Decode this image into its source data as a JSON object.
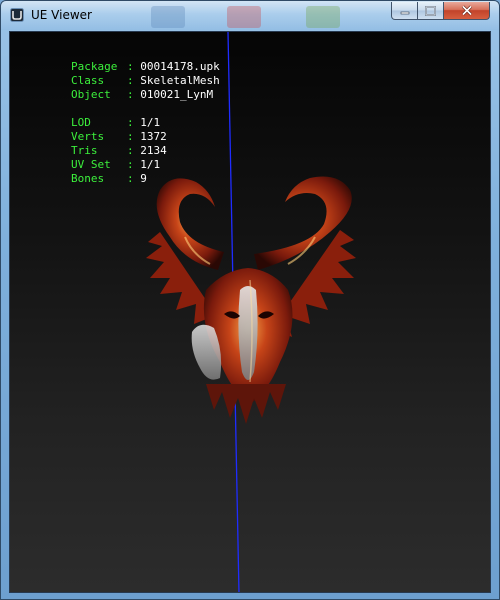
{
  "window": {
    "title": "UE Viewer",
    "icon": "ue-viewer-app-icon",
    "controls": {
      "minimize": "minimize-icon",
      "maximize": "maximize-icon",
      "close": "close-icon"
    }
  },
  "info_primary": [
    {
      "label": "Package",
      "sep": ":",
      "value": "00014178.upk"
    },
    {
      "label": "Class",
      "sep": ":",
      "value": "SkeletalMesh"
    },
    {
      "label": "Object",
      "sep": ":",
      "value": "010021_LynM"
    }
  ],
  "info_stats": [
    {
      "label": "LOD",
      "sep": ":",
      "value": "1/1"
    },
    {
      "label": "Verts",
      "sep": ":",
      "value": "1372"
    },
    {
      "label": "Tris",
      "sep": ":",
      "value": "2134"
    },
    {
      "label": "UV Set",
      "sep": ":",
      "value": "1/1"
    },
    {
      "label": "Bones",
      "sep": ":",
      "value": "9"
    }
  ],
  "colors": {
    "label_green": "#3cf03c",
    "value_white": "#ffffff",
    "axis_blue": "#1f2cff",
    "mesh_red": "#b52a10",
    "mesh_highlight": "#f3a34a",
    "mesh_silver": "#c8c8c8"
  }
}
